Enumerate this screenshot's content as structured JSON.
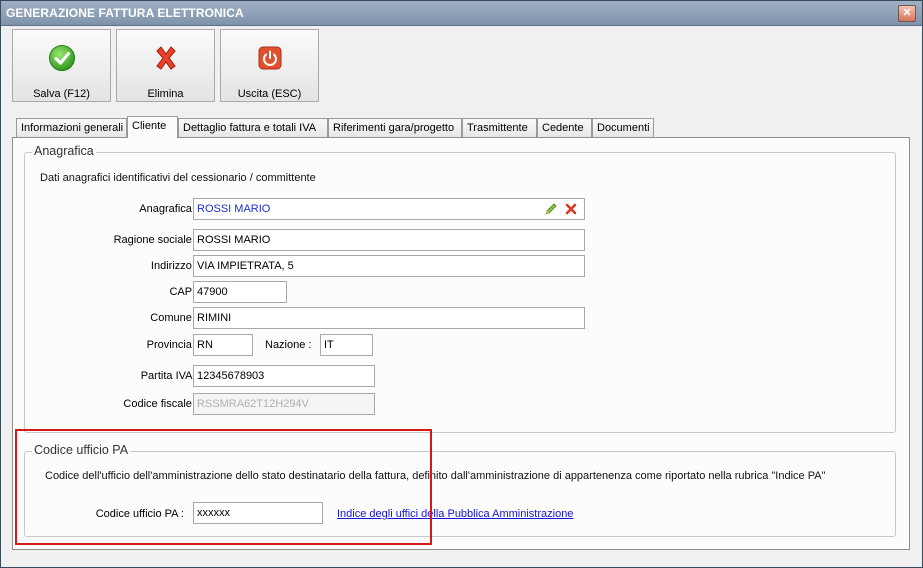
{
  "window": {
    "title": "GENERAZIONE FATTURA ELETTRONICA",
    "close_glyph": "✕"
  },
  "toolbar": {
    "save_label": "Salva (F12)",
    "delete_label": "Elimina",
    "exit_label": "Uscita (ESC)",
    "icons": {
      "save": "check-circle-icon",
      "delete": "red-x-icon",
      "exit": "power-icon"
    }
  },
  "tabs": [
    {
      "label": "Informazioni generali",
      "active": false
    },
    {
      "label": "Cliente",
      "active": true
    },
    {
      "label": "Dettaglio fattura e totali IVA",
      "active": false
    },
    {
      "label": "Riferimenti gara/progetto",
      "active": false
    },
    {
      "label": "Trasmittente",
      "active": false
    },
    {
      "label": "Cedente",
      "active": false
    },
    {
      "label": "Documenti",
      "active": false
    }
  ],
  "anagrafica_group": {
    "title": "Anagrafica",
    "description": "Dati anagrafici identificativi del cessionario / committente",
    "fields": {
      "anagrafica": {
        "label": "Anagrafica :",
        "value": "ROSSI MARIO"
      },
      "ragione_sociale": {
        "label": "Ragione sociale :",
        "value": "ROSSI MARIO"
      },
      "indirizzo": {
        "label": "Indirizzo :",
        "value": "VIA IMPIETRATA, 5"
      },
      "cap": {
        "label": "CAP :",
        "value": "47900"
      },
      "comune": {
        "label": "Comune :",
        "value": "RIMINI"
      },
      "provincia": {
        "label": "Provincia :",
        "value": "RN"
      },
      "nazione": {
        "label": "Nazione :",
        "value": "IT"
      },
      "partita_iva": {
        "label": "Partita IVA :",
        "value": "12345678903"
      },
      "codice_fiscale": {
        "label": "Codice fiscale :",
        "value": "RSSMRA62T12H294V"
      }
    }
  },
  "ufficio_group": {
    "title": "Codice ufficio PA",
    "description": "Codice dell'ufficio dell'amministrazione dello stato destinatario della fattura, definito dall'amministrazione di appartenenza come riportato nella rubrica \"Indice PA\"",
    "field": {
      "label": "Codice ufficio PA :",
      "value": "xxxxxx"
    },
    "link": "Indice degli uffici della Pubblica Amministrazione"
  },
  "colors": {
    "titlebar": "#8ea2b9",
    "highlight_box": "#d51818",
    "link": "#1414d8",
    "anagrafica_value": "#1a2fd0"
  }
}
